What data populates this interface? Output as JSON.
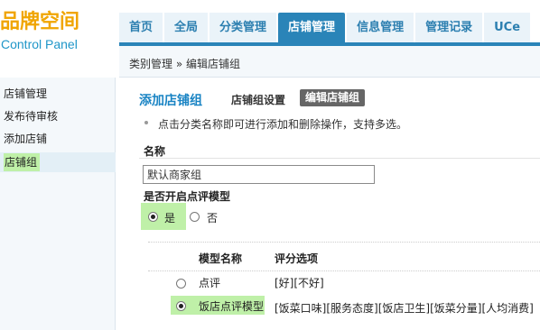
{
  "logo": {
    "cn": "品牌空间",
    "en": "Control Panel"
  },
  "topnav": [
    {
      "label": "首页",
      "active": false
    },
    {
      "label": "全局",
      "active": false
    },
    {
      "label": "分类管理",
      "active": false
    },
    {
      "label": "店铺管理",
      "active": true
    },
    {
      "label": "信息管理",
      "active": false
    },
    {
      "label": "管理记录",
      "active": false
    },
    {
      "label": "UCe",
      "active": false
    }
  ],
  "breadcrumb": "类别管理 » 编辑店铺组",
  "sidebar": {
    "items": [
      {
        "label": "店铺管理"
      },
      {
        "label": "发布待审核"
      },
      {
        "label": "添加店铺"
      },
      {
        "label": "店铺组",
        "active": true
      }
    ]
  },
  "main": {
    "title": "添加店铺组",
    "subtab_settings": "店铺组设置",
    "subtab_edit": "编辑店铺组",
    "hint": "点击分类名称即可进行添加和删除操作，支持多选。",
    "name_label": "名称",
    "name_value": "默认商家组",
    "model_label": "是否开启点评模型",
    "yes_label": "是",
    "no_label": "否",
    "table": {
      "col_name": "模型名称",
      "col_options": "评分选项",
      "rows": [
        {
          "name": "点评",
          "options": "[好][不好]",
          "selected": false
        },
        {
          "name": "饭店点评模型",
          "options": "[饭菜口味][服务态度][饭店卫生][饭菜分量][人均消费]",
          "selected": true
        }
      ]
    }
  },
  "colors": {
    "accent": "#2a84b8",
    "highlight": "#bff0a8",
    "title": "#1a84c4"
  }
}
